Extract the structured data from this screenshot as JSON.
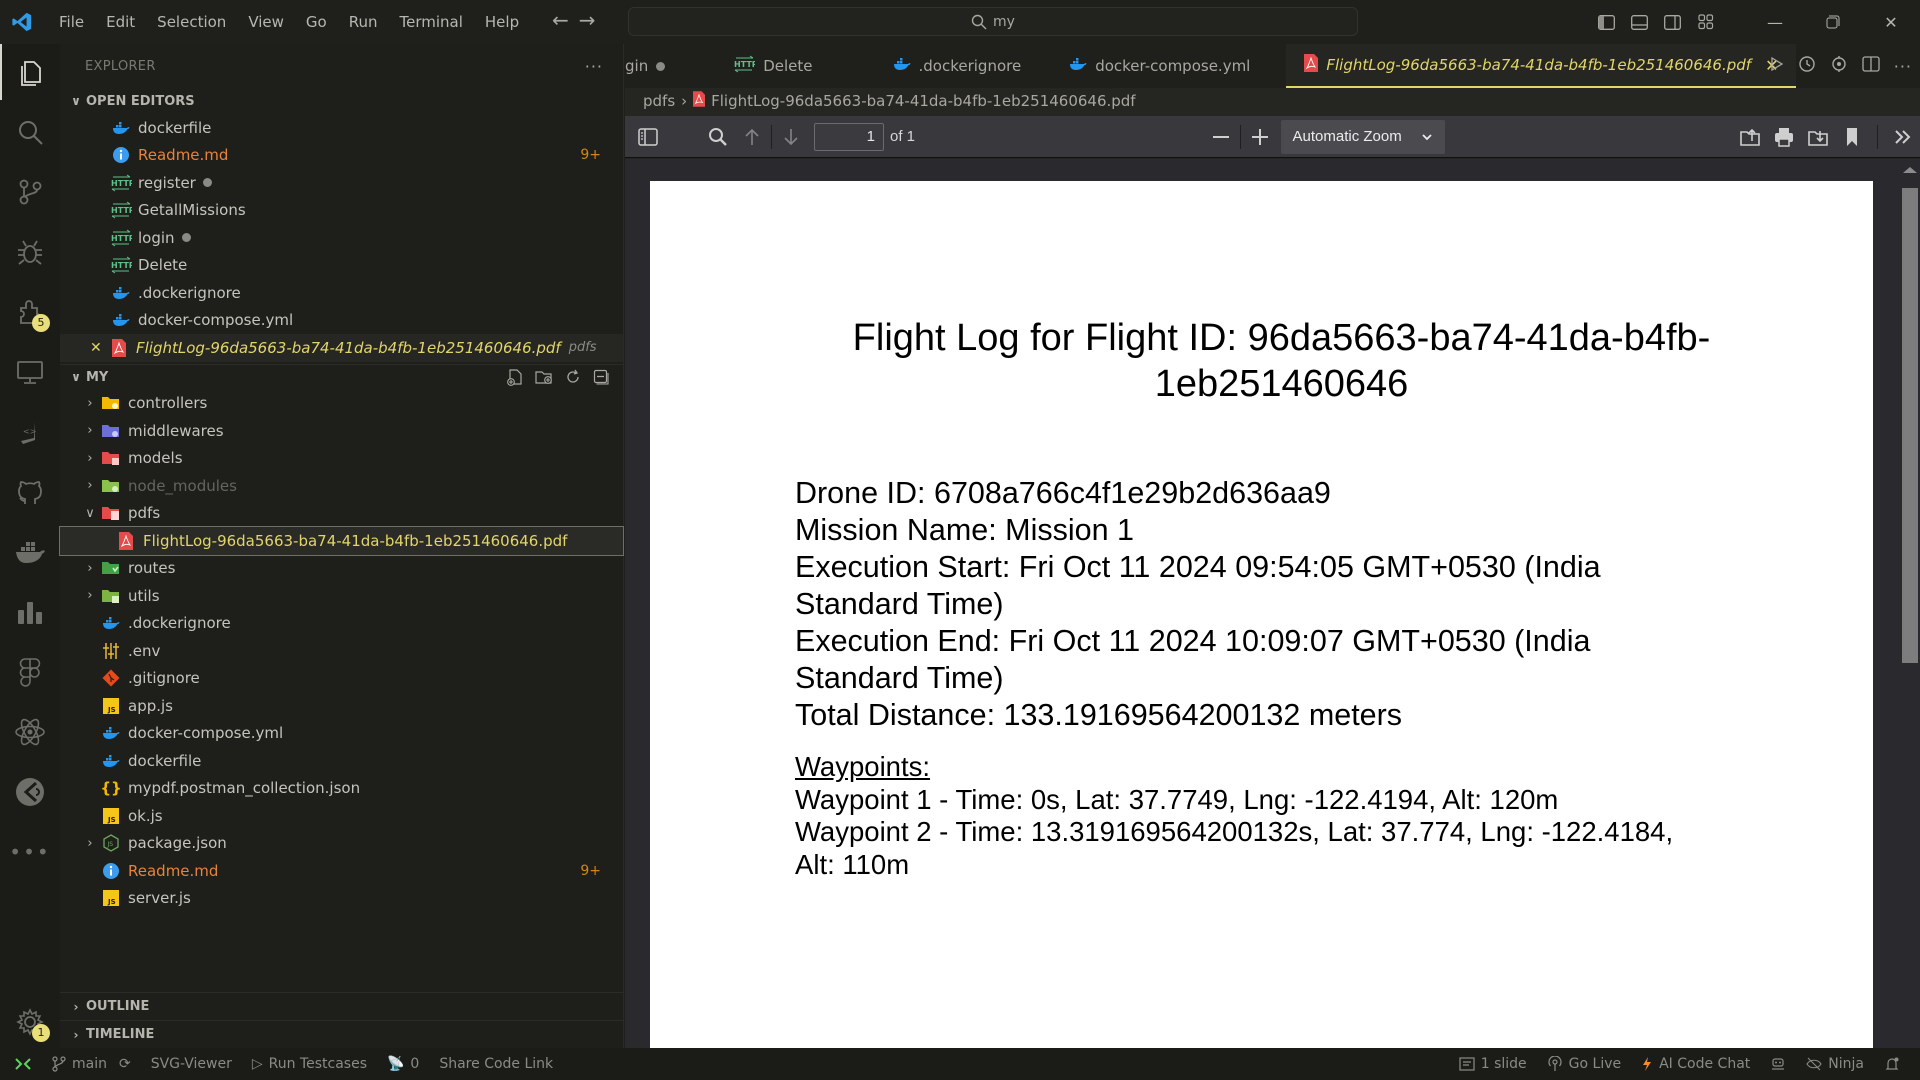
{
  "titlebar": {
    "menu": [
      "File",
      "Edit",
      "Selection",
      "View",
      "Go",
      "Run",
      "Terminal",
      "Help"
    ],
    "search_text": "my",
    "layout_icons": [
      "toggle-primary-sidebar",
      "toggle-panel",
      "toggle-secondary-sidebar",
      "customize-layout"
    ],
    "window_controls": [
      "minimize",
      "restore",
      "close"
    ]
  },
  "activity_bar": {
    "items": [
      {
        "name": "explorer",
        "active": true
      },
      {
        "name": "search"
      },
      {
        "name": "source-control"
      },
      {
        "name": "run-debug"
      },
      {
        "name": "extensions",
        "badge": "5"
      },
      {
        "name": "remote-explorer"
      },
      {
        "name": "thunder-client"
      },
      {
        "name": "github"
      },
      {
        "name": "docker"
      },
      {
        "name": "analytics"
      },
      {
        "name": "figma"
      },
      {
        "name": "react"
      },
      {
        "name": "live-share"
      },
      {
        "name": "more"
      }
    ],
    "accounts_badge": "1"
  },
  "sidebar": {
    "title": "EXPLORER",
    "open_editors": {
      "label": "OPEN EDITORS",
      "items": [
        {
          "name": "dockerfile",
          "icon": "docker"
        },
        {
          "name": "Readme.md",
          "icon": "info",
          "modified": true,
          "badge": "9+"
        },
        {
          "name": "register",
          "icon": "http",
          "dirty": true
        },
        {
          "name": "GetallMissions",
          "icon": "http"
        },
        {
          "name": "login",
          "icon": "http",
          "dirty": true
        },
        {
          "name": "Delete",
          "icon": "http"
        },
        {
          "name": ".dockerignore",
          "icon": "docker"
        },
        {
          "name": "docker-compose.yml",
          "icon": "docker"
        },
        {
          "name": "FlightLog-96da5663-ba74-41da-b4fb-1eb251460646.pdf",
          "icon": "pdf",
          "hint": "pdfs",
          "active": true
        }
      ]
    },
    "project": {
      "label": "MY",
      "actions": [
        "new-file",
        "new-folder",
        "refresh",
        "collapse-all"
      ],
      "items": [
        {
          "name": "controllers",
          "type": "folder",
          "color": "#f5b800"
        },
        {
          "name": "middlewares",
          "type": "folder",
          "color": "#6b6fd6"
        },
        {
          "name": "models",
          "type": "folder",
          "color": "#e54b4b"
        },
        {
          "name": "node_modules",
          "type": "folder",
          "color": "#8bc34a",
          "dim": true
        },
        {
          "name": "pdfs",
          "type": "folder",
          "color": "#e54b4b",
          "open": true
        },
        {
          "name": "FlightLog-96da5663-ba74-41da-b4fb-1eb251460646.pdf",
          "type": "pdf",
          "selected": true
        },
        {
          "name": "routes",
          "type": "folder",
          "color": "#43a047"
        },
        {
          "name": "utils",
          "type": "folder",
          "color": "#7cb342"
        },
        {
          "name": ".dockerignore",
          "type": "docker"
        },
        {
          "name": ".env",
          "type": "env"
        },
        {
          "name": ".gitignore",
          "type": "git"
        },
        {
          "name": "app.js",
          "type": "js"
        },
        {
          "name": "docker-compose.yml",
          "type": "docker"
        },
        {
          "name": "dockerfile",
          "type": "docker"
        },
        {
          "name": "mypdf.postman_collection.json",
          "type": "json"
        },
        {
          "name": "ok.js",
          "type": "js"
        },
        {
          "name": "package.json",
          "type": "node",
          "expandable": true
        },
        {
          "name": "Readme.md",
          "type": "info",
          "modified": true,
          "badge": "9+"
        },
        {
          "name": "server.js",
          "type": "js"
        }
      ]
    },
    "outline_label": "OUTLINE",
    "timeline_label": "TIMELINE"
  },
  "editor": {
    "tabs": [
      {
        "label": "gin",
        "icon": "http",
        "dirty": true
      },
      {
        "label": "Delete",
        "icon": "http"
      },
      {
        "label": ".dockerignore",
        "icon": "docker"
      },
      {
        "label": "docker-compose.yml",
        "icon": "docker"
      },
      {
        "label": "FlightLog-96da5663-ba74-41da-b4fb-1eb251460646.pdf",
        "icon": "pdf",
        "active": true
      }
    ],
    "breadcrumb": [
      "pdfs",
      "FlightLog-96da5663-ba74-41da-b4fb-1eb251460646.pdf"
    ],
    "pdf_toolbar": {
      "page_number": "1",
      "page_count_label": "of 1",
      "zoom_label": "Automatic Zoom"
    },
    "pdf": {
      "title": "Flight Log for Flight ID: 96da5663-ba74-41da-b4fb-1eb251460646",
      "drone_id": "Drone ID: 6708a766c4f1e29b2d636aa9",
      "mission_name": "Mission Name: Mission 1",
      "execution_start": "Execution Start: Fri Oct 11 2024 09:54:05 GMT+0530 (India Standard Time)",
      "execution_end": "Execution End: Fri Oct 11 2024 10:09:07 GMT+0530 (India Standard Time)",
      "total_distance": "Total Distance: 133.19169564200132 meters",
      "waypoints_heading": "Waypoints:",
      "waypoints": [
        "Waypoint 1 - Time: 0s, Lat: 37.7749, Lng: -122.4194, Alt: 120m",
        "Waypoint 2 - Time: 13.319169564200132s, Lat: 37.774, Lng: -122.4184, Alt: 110m"
      ]
    }
  },
  "statusbar": {
    "branch": "main",
    "svg_viewer": "SVG-Viewer",
    "run_testcases": "Run Testcases",
    "ports": "0",
    "share": "Share Code Link",
    "slides": "1 slide",
    "go_live": "Go Live",
    "ai_chat": "AI Code Chat",
    "ninja": "Ninja"
  }
}
